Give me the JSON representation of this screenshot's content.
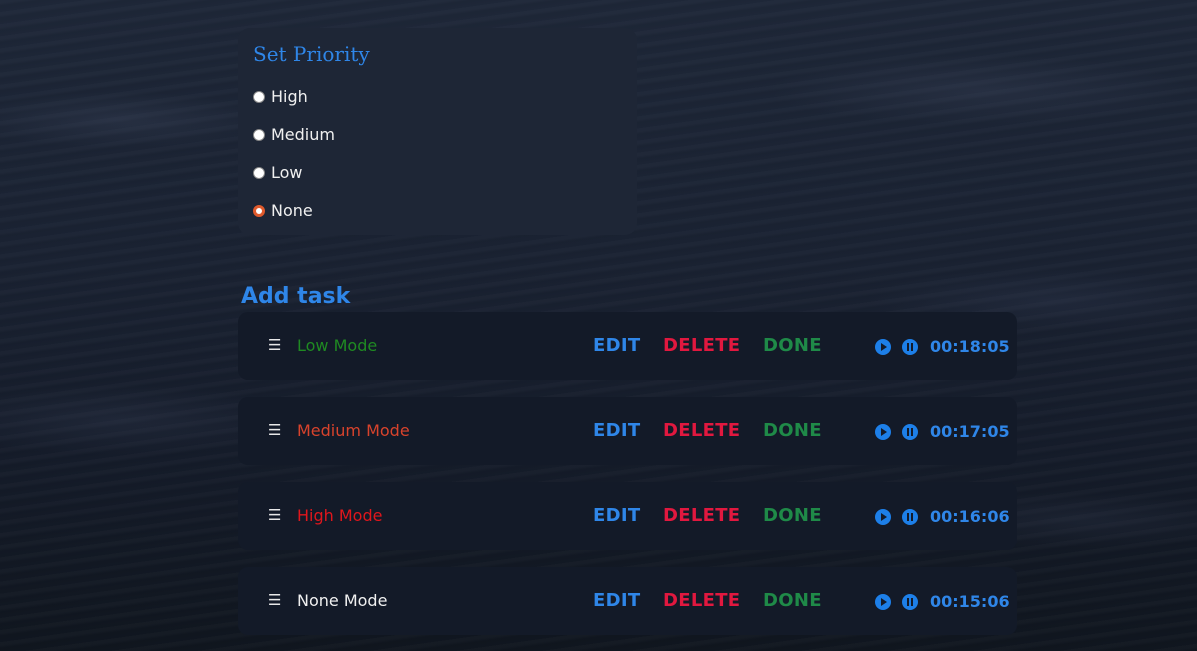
{
  "priority": {
    "title": "Set Priority",
    "options": [
      {
        "label": "High",
        "checked": false
      },
      {
        "label": "Medium",
        "checked": false
      },
      {
        "label": "Low",
        "checked": false
      },
      {
        "label": "None",
        "checked": true
      }
    ]
  },
  "add_task": {
    "label": "Add task"
  },
  "actions": {
    "edit": "EDIT",
    "delete": "DELETE",
    "done": "DONE"
  },
  "tasks": [
    {
      "drag": "☰",
      "name": "Low Mode",
      "color": "#1f8a22",
      "timer": "00:18:05"
    },
    {
      "drag": "☰",
      "name": "Medium Mode",
      "color": "#d8432c",
      "timer": "00:17:05"
    },
    {
      "drag": "☰",
      "name": "High Mode",
      "color": "#e0161c",
      "timer": "00:16:06"
    },
    {
      "drag": "☰",
      "name": "None Mode",
      "color": "#f0f0f0",
      "timer": "00:15:06"
    }
  ],
  "colors": {
    "accent": "#2f86e8",
    "delete": "#e1183f",
    "done": "#1f8a48",
    "radio_checked": "#e05a2c"
  },
  "icons": {
    "drag": "drag-handle-icon",
    "play": "play-icon",
    "pause": "pause-icon"
  }
}
